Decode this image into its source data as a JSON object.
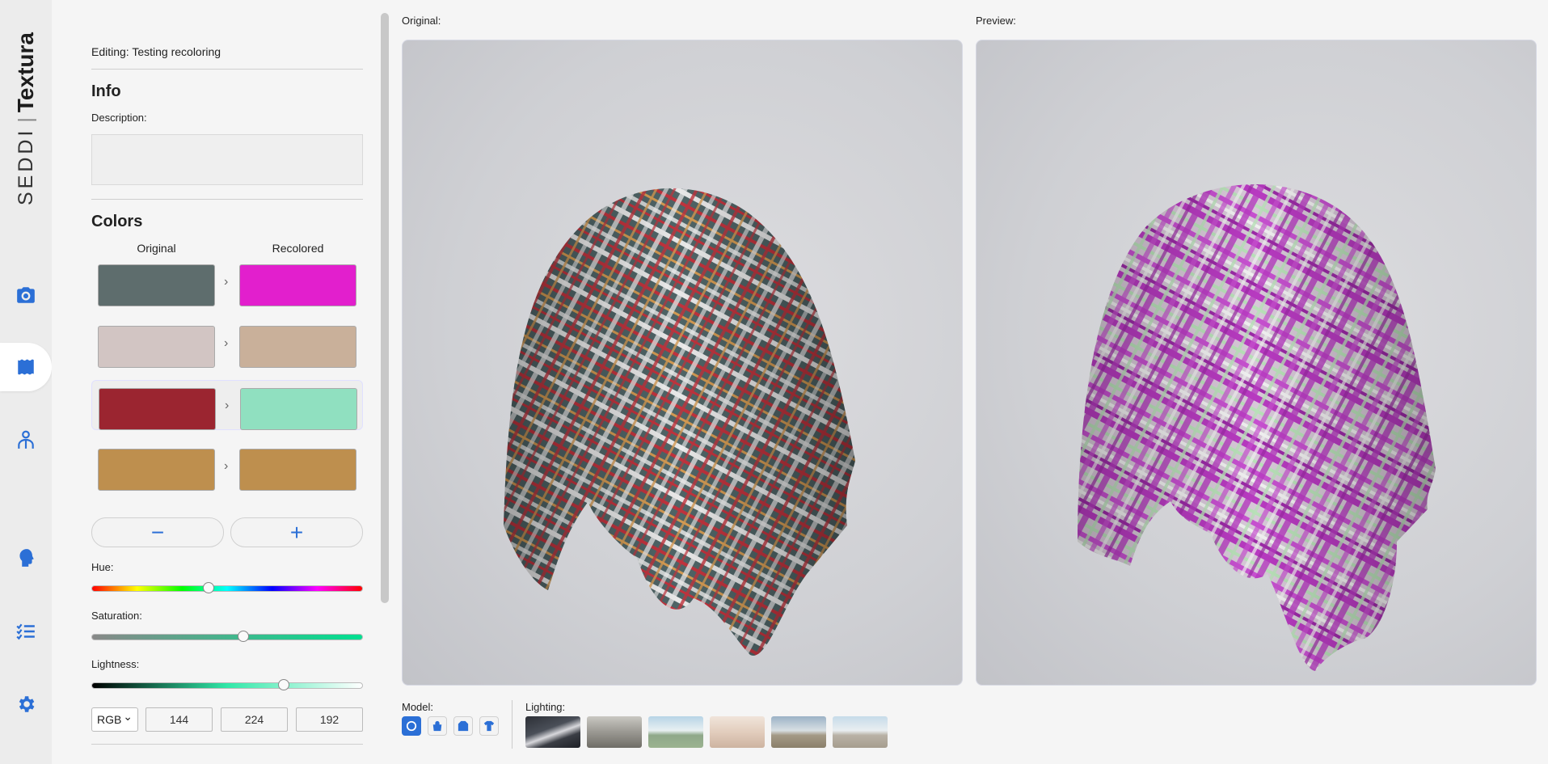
{
  "brand": {
    "prefix": "SEDDI",
    "separator": "|",
    "name": "Textura"
  },
  "nav": [
    {
      "id": "camera",
      "icon": "camera-icon",
      "active": false
    },
    {
      "id": "fabric",
      "icon": "fabric-icon",
      "active": true
    },
    {
      "id": "avatar",
      "icon": "avatar-icon",
      "active": false
    },
    {
      "id": "head",
      "icon": "head-icon",
      "active": false
    },
    {
      "id": "checklist",
      "icon": "checklist-icon",
      "active": false
    },
    {
      "id": "settings",
      "icon": "gear-icon",
      "active": false
    }
  ],
  "sidebar": {
    "editing": "Editing: Testing recoloring",
    "info_title": "Info",
    "description_label": "Description:",
    "description_value": "",
    "colors_title": "Colors",
    "original_header": "Original",
    "recolored_header": "Recolored",
    "color_pairs": [
      {
        "original": "#5e6d6d",
        "recolored": "#e21fcd",
        "selected": false
      },
      {
        "original": "#d2c5c3",
        "recolored": "#c9b09a",
        "selected": false
      },
      {
        "original": "#9b2530",
        "recolored": "#90e0c0",
        "selected": true
      },
      {
        "original": "#be8f4e",
        "recolored": "#be8f4e",
        "selected": false
      }
    ],
    "remove_label": "−",
    "add_label": "+",
    "hue_label": "Hue:",
    "hue_value": 0.43,
    "saturation_label": "Saturation:",
    "saturation_value": 0.56,
    "lightness_label": "Lightness:",
    "lightness_value": 0.71,
    "color_mode": "RGB",
    "rgb": [
      "144",
      "224",
      "192"
    ]
  },
  "viewer": {
    "original_label": "Original:",
    "preview_label": "Preview:"
  },
  "bottom": {
    "model_label": "Model:",
    "models": [
      {
        "icon": "sphere-icon",
        "active": true
      },
      {
        "icon": "bag-icon",
        "active": false
      },
      {
        "icon": "jacket-icon",
        "active": false
      },
      {
        "icon": "tshirt-icon",
        "active": false
      }
    ],
    "lighting_label": "Lighting:",
    "lighting_count": 6
  },
  "colors": {
    "accent": "#2b6fd6"
  }
}
